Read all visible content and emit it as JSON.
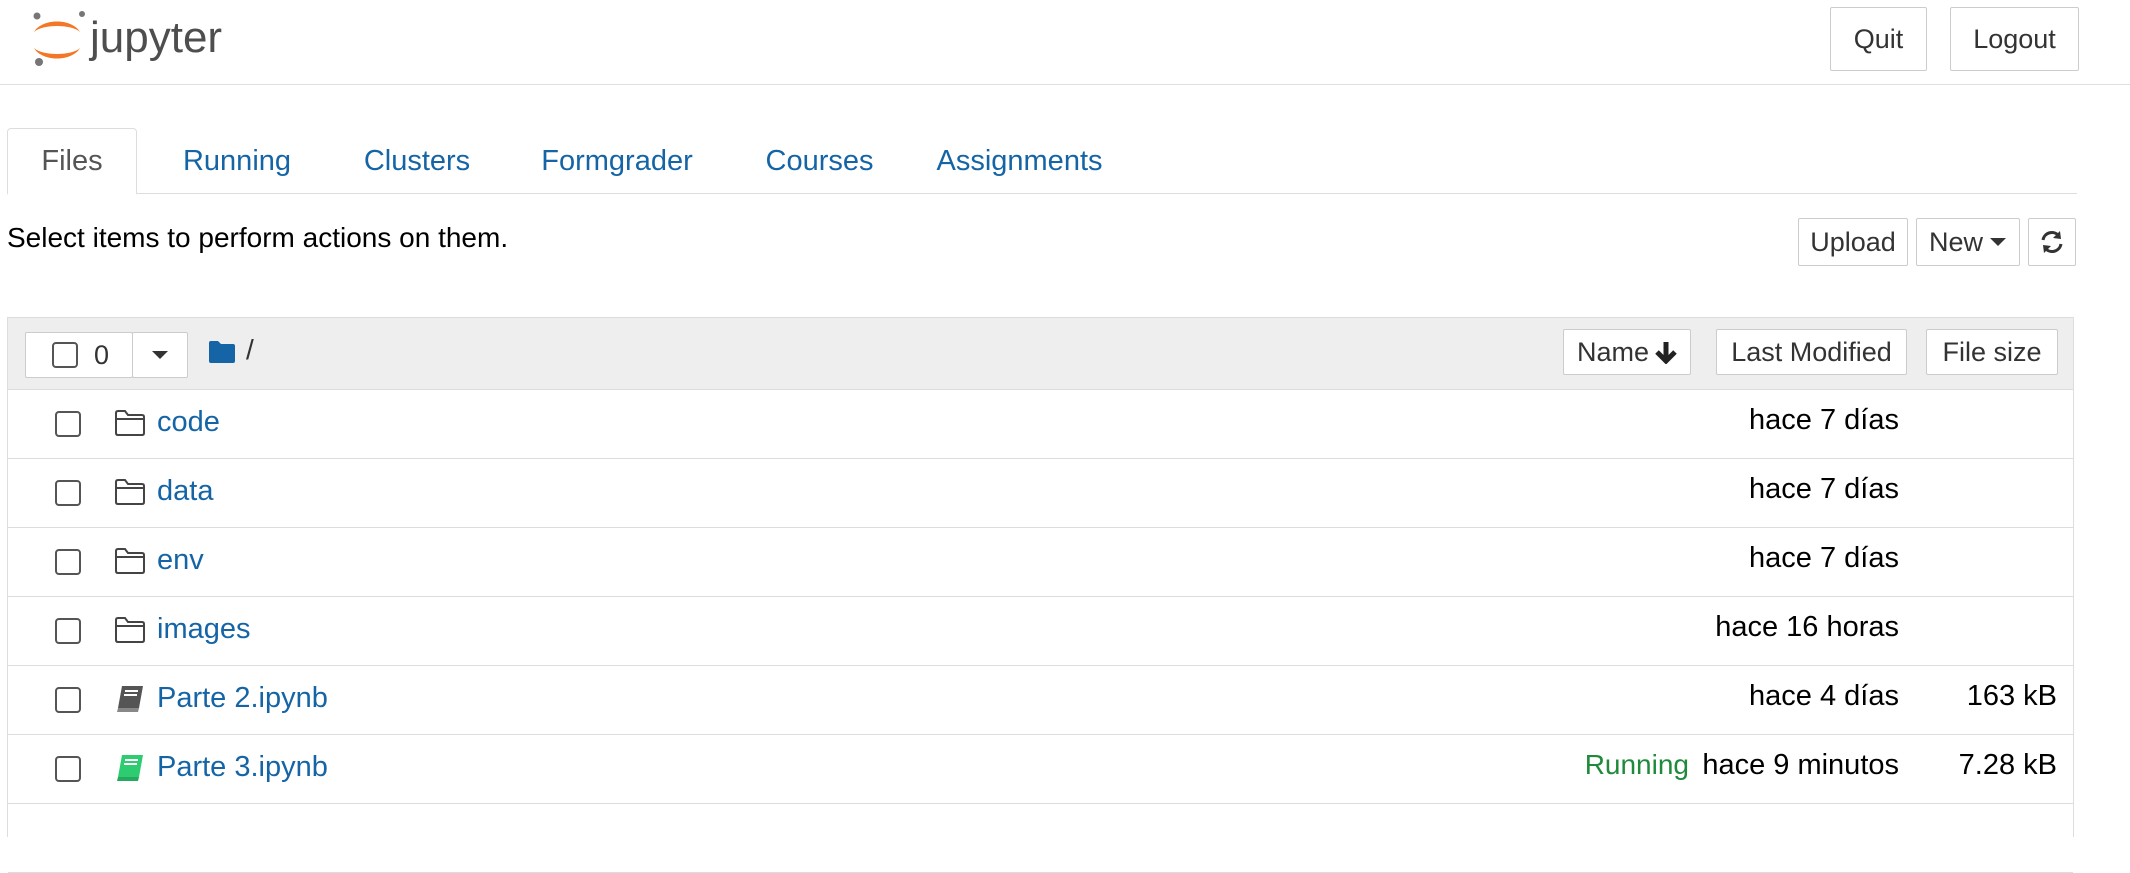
{
  "header": {
    "logo_text": "jupyter",
    "quit_label": "Quit",
    "logout_label": "Logout"
  },
  "tabs": [
    {
      "label": "Files",
      "active": true
    },
    {
      "label": "Running"
    },
    {
      "label": "Clusters"
    },
    {
      "label": "Formgrader"
    },
    {
      "label": "Courses"
    },
    {
      "label": "Assignments"
    }
  ],
  "toolbar": {
    "hint": "Select items to perform actions on them.",
    "upload_label": "Upload",
    "new_label": "New",
    "refresh_icon": "refresh-icon"
  },
  "list_header": {
    "selected_count": "0",
    "breadcrumb_path": "/",
    "sort_name_label": "Name",
    "sort_modified_label": "Last Modified",
    "sort_size_label": "File size"
  },
  "files": [
    {
      "name": "code",
      "type": "folder",
      "modified": "hace 7 días",
      "size": ""
    },
    {
      "name": "data",
      "type": "folder",
      "modified": "hace 7 días",
      "size": ""
    },
    {
      "name": "env",
      "type": "folder",
      "modified": "hace 7 días",
      "size": ""
    },
    {
      "name": "images",
      "type": "folder",
      "modified": "hace 16 horas",
      "size": ""
    },
    {
      "name": "Parte 2.ipynb",
      "type": "notebook",
      "modified": "hace 4 días",
      "size": "163 kB"
    },
    {
      "name": "Parte 3.ipynb",
      "type": "notebook-running",
      "status": "Running",
      "modified": "hace 9 minutos",
      "size": "7.28 kB"
    }
  ],
  "colors": {
    "link": "#1565a6",
    "running": "#1f8a3a",
    "logo_orange": "#f37726",
    "running_notebook_icon": "#2ecc71"
  }
}
